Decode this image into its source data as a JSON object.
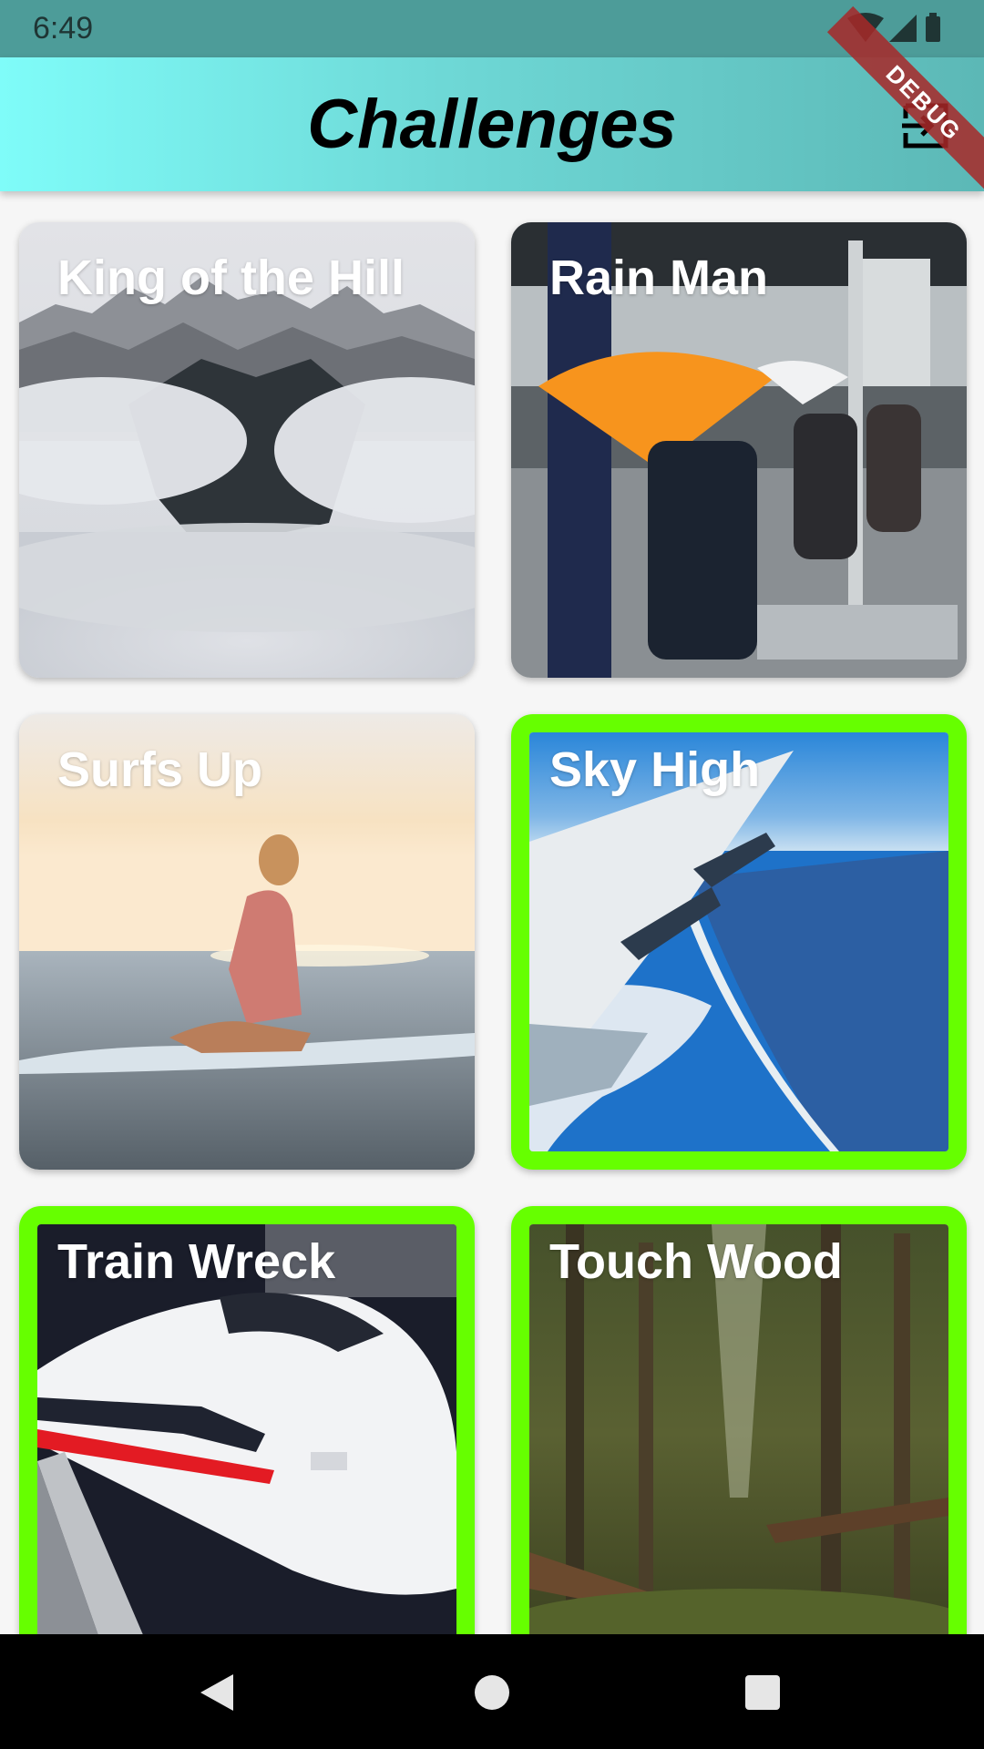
{
  "status_bar": {
    "time": "6:49"
  },
  "app_bar": {
    "title": "Challenges",
    "debug_label": "DEBUG"
  },
  "challenges": [
    {
      "title": "King of the Hill",
      "selected": false
    },
    {
      "title": "Rain Man",
      "selected": false
    },
    {
      "title": "Surfs Up",
      "selected": false
    },
    {
      "title": "Sky High",
      "selected": true
    },
    {
      "title": "Train Wreck",
      "selected": true
    },
    {
      "title": "Touch Wood",
      "selected": true
    }
  ],
  "colors": {
    "accent_border": "#66ff00",
    "app_bar_start": "#7ffcf9",
    "app_bar_end": "#5cb8b6",
    "status_bar": "#4d9c99"
  },
  "icons": {
    "exit": "exit-to-app-icon",
    "wifi": "wifi-icon",
    "signal": "signal-icon",
    "battery": "battery-icon",
    "back": "back-triangle-icon",
    "home": "home-circle-icon",
    "recents": "recents-square-icon"
  }
}
